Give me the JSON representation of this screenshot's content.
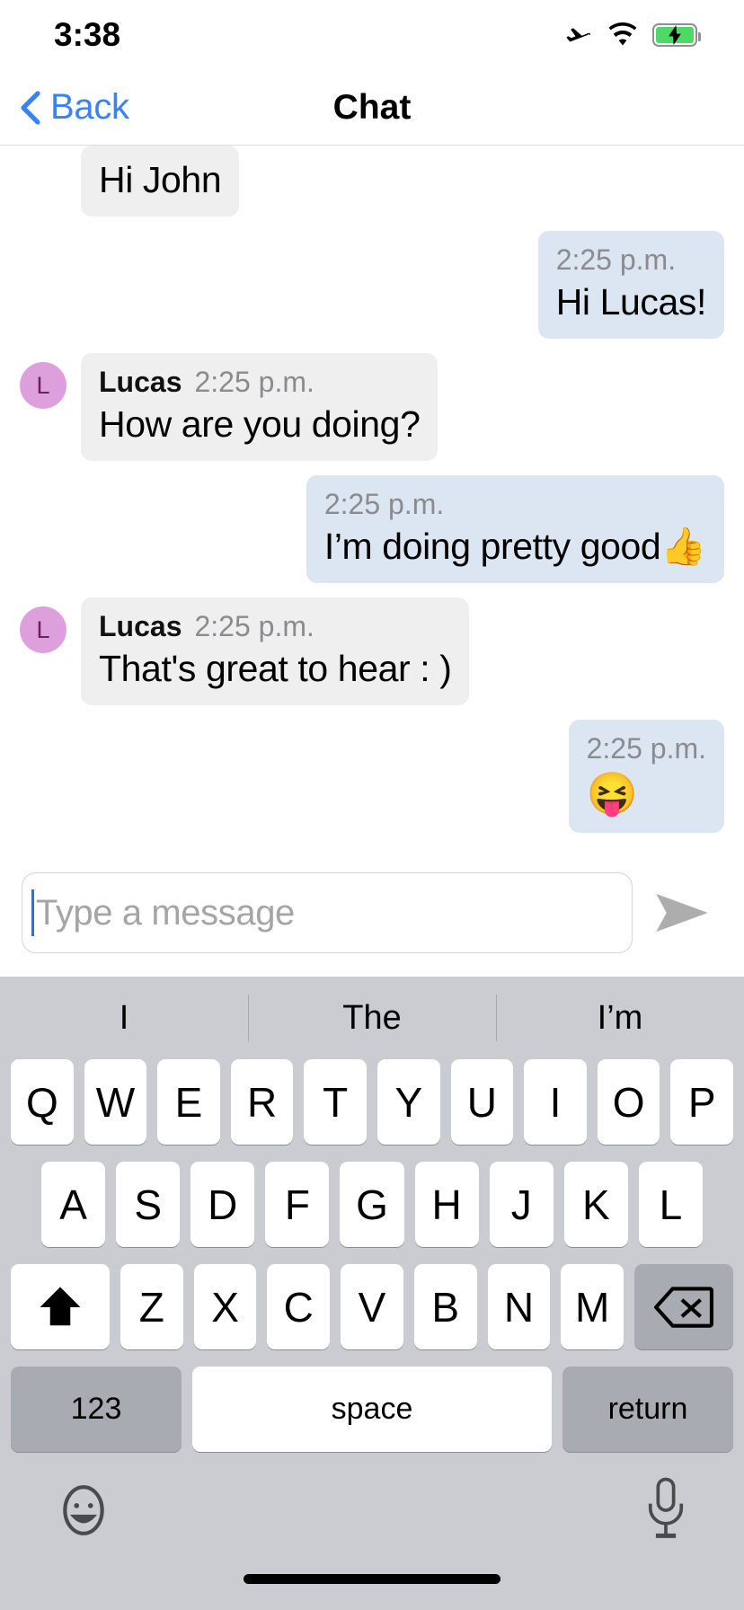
{
  "status_bar": {
    "time": "3:38",
    "icons": [
      "airplane-mode-icon",
      "wifi-icon",
      "battery-charging-icon"
    ]
  },
  "nav_bar": {
    "back_label": "Back",
    "title": "Chat",
    "accent_color": "#3a82f7"
  },
  "messages": [
    {
      "id": "m1",
      "direction": "in",
      "sender": "",
      "time": "",
      "text": "Hi John",
      "clipped": true,
      "show_avatar": false,
      "show_header": false
    },
    {
      "id": "m2",
      "direction": "out",
      "sender": "",
      "time": "2:25 p.m.",
      "text": "Hi Lucas!",
      "clipped": false,
      "show_avatar": false,
      "show_header": true
    },
    {
      "id": "m3",
      "direction": "in",
      "sender": "Lucas",
      "time": "2:25 p.m.",
      "text": "How are you doing?",
      "clipped": false,
      "show_avatar": true,
      "avatar_initial": "L",
      "show_header": true
    },
    {
      "id": "m4",
      "direction": "out",
      "sender": "",
      "time": "2:25 p.m.",
      "text": "I’m doing pretty good👍",
      "clipped": false,
      "show_avatar": false,
      "show_header": true
    },
    {
      "id": "m5",
      "direction": "in",
      "sender": "Lucas",
      "time": "2:25 p.m.",
      "text": "That's great to hear : )",
      "clipped": false,
      "show_avatar": true,
      "avatar_initial": "L",
      "show_header": true
    },
    {
      "id": "m6",
      "direction": "out",
      "sender": "",
      "time": "2:25 p.m.",
      "text": "😝",
      "clipped": false,
      "show_avatar": false,
      "show_header": true,
      "emoji_only": true
    }
  ],
  "composer": {
    "placeholder": "Type a message",
    "value": "",
    "send_icon": "send-arrow-icon",
    "caret_color": "#2b6ef5"
  },
  "keyboard": {
    "suggestions": [
      "I",
      "The",
      "I’m"
    ],
    "row1": [
      "Q",
      "W",
      "E",
      "R",
      "T",
      "Y",
      "U",
      "I",
      "O",
      "P"
    ],
    "row2": [
      "A",
      "S",
      "D",
      "F",
      "G",
      "H",
      "J",
      "K",
      "L"
    ],
    "row3_letters": [
      "Z",
      "X",
      "C",
      "V",
      "B",
      "N",
      "M"
    ],
    "shift_label": "shift-icon",
    "backspace_label": "backspace-icon",
    "num_label": "123",
    "space_label": "space",
    "return_label": "return",
    "emoji_label": "emoji-icon",
    "mic_label": "microphone-icon",
    "bg_color": "#cbccd1",
    "key_color": "#ffffff",
    "dark_key_color": "#a9abb2"
  },
  "colors": {
    "incoming_bubble": "#efeff0",
    "outgoing_bubble": "#dce6f2",
    "avatar_bg": "#dda0dd",
    "avatar_text": "#6b2060",
    "timestamp": "#8b8b8f"
  }
}
